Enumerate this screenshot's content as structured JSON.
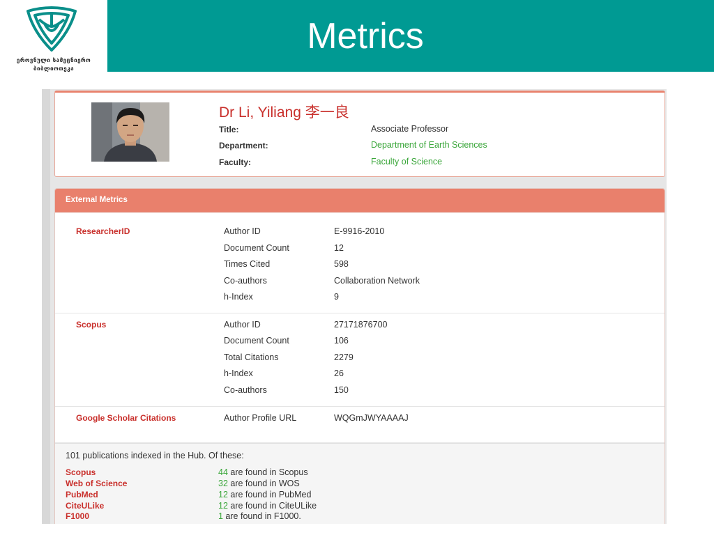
{
  "slide": {
    "title": "Metrics",
    "logo_text_line1": "ეროვნული სამეცნიერო",
    "logo_text_line2": "ბიბლიოთეკა"
  },
  "profile": {
    "name": "Dr Li, Yiliang 李一良",
    "fields": [
      {
        "label": "Title:",
        "value": "Associate Professor",
        "link": false
      },
      {
        "label": "Department:",
        "value": "Department of Earth Sciences",
        "link": true
      },
      {
        "label": "Faculty:",
        "value": "Faculty of Science",
        "link": true
      }
    ]
  },
  "metrics": {
    "header": "External Metrics",
    "sections": [
      {
        "name": "ResearcherID",
        "rows": [
          {
            "label": "Author ID",
            "value": "E-9916-2010",
            "link": true
          },
          {
            "label": "Document Count",
            "value": "12",
            "link": true
          },
          {
            "label": "Times Cited",
            "value": "598",
            "link": true
          },
          {
            "label": "Co-authors",
            "value": "Collaboration Network",
            "link": true
          },
          {
            "label": "h-Index",
            "value": "9",
            "link": false
          }
        ]
      },
      {
        "name": "Scopus",
        "rows": [
          {
            "label": "Author ID",
            "value": "27171876700",
            "link": true
          },
          {
            "label": "Document Count",
            "value": "106",
            "link": true
          },
          {
            "label": "Total Citations",
            "value": "2279",
            "link": true
          },
          {
            "label": "h-Index",
            "value": "26",
            "link": false
          },
          {
            "label": "Co-authors",
            "value": "150",
            "link": true
          }
        ]
      },
      {
        "name": "Google Scholar Citations",
        "rows": [
          {
            "label": "Author Profile URL",
            "value": "WQGmJWYAAAAJ",
            "link": true
          }
        ]
      }
    ]
  },
  "hub": {
    "intro": "101 publications indexed in the Hub. Of these:",
    "items": [
      {
        "name": "Scopus",
        "count": "44",
        "text": " are found in Scopus"
      },
      {
        "name": "Web of Science",
        "count": "32",
        "text": " are found in WOS"
      },
      {
        "name": "PubMed",
        "count": "12",
        "text": " are found in PubMed"
      },
      {
        "name": "CiteULike",
        "count": "12",
        "text": " are found in CiteULike"
      },
      {
        "name": "F1000",
        "count": "1",
        "text": " are found in F1000."
      }
    ]
  },
  "colors": {
    "header_teal": "#009a93",
    "panel_header": "#e9806c",
    "accent_red": "#c9302c",
    "link_green": "#3aa63a"
  }
}
